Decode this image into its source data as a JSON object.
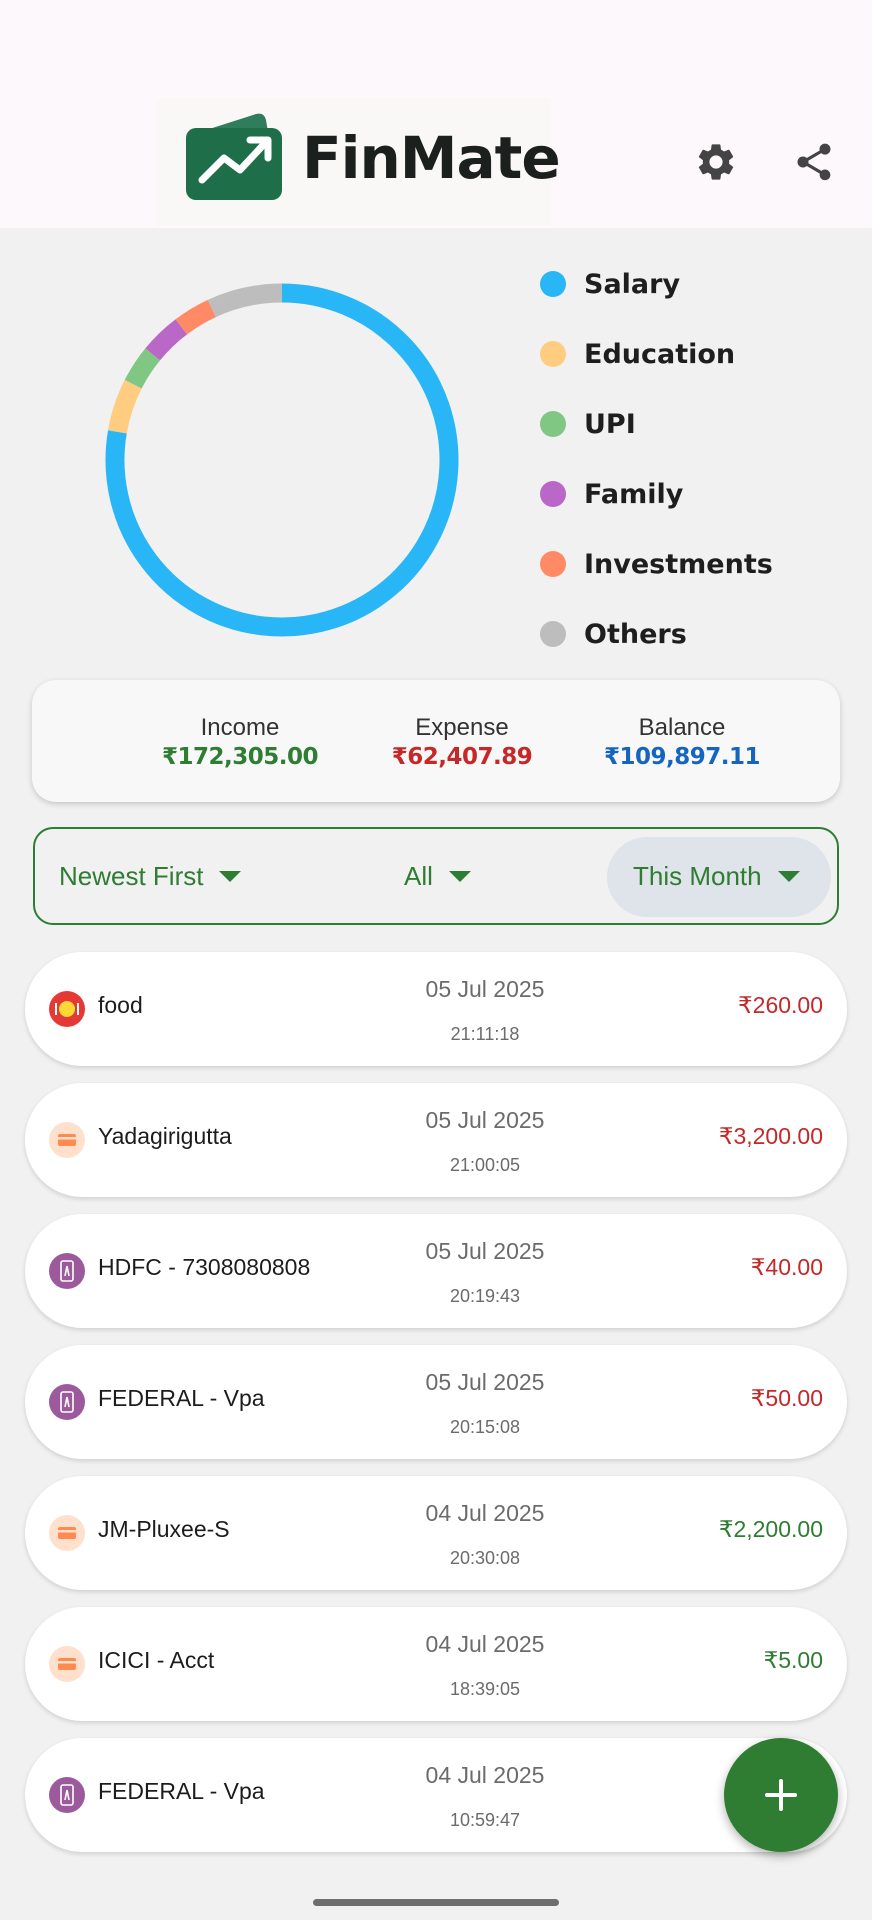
{
  "app": {
    "name": "FinMate"
  },
  "chart_data": {
    "type": "pie",
    "categories": [
      "Salary",
      "Education",
      "UPI",
      "Family",
      "Investments",
      "Others"
    ],
    "values": [
      77.7,
      4.8,
      3.4,
      3.8,
      3.4,
      6.9
    ],
    "colors": [
      "#29b6f6",
      "#ffcc80",
      "#81c784",
      "#ba68c8",
      "#ff8a65",
      "#bdbdbd"
    ],
    "legend_position": "right"
  },
  "legend": [
    {
      "label": "Salary",
      "color": "#29b6f6"
    },
    {
      "label": "Education",
      "color": "#ffcc80"
    },
    {
      "label": "UPI",
      "color": "#81c784"
    },
    {
      "label": "Family",
      "color": "#ba68c8"
    },
    {
      "label": "Investments",
      "color": "#ff8a65"
    },
    {
      "label": "Others",
      "color": "#bdbdbd"
    }
  ],
  "summary": {
    "income_label": "Income",
    "income_value": "₹172,305.00",
    "expense_label": "Expense",
    "expense_value": "₹62,407.89",
    "balance_label": "Balance",
    "balance_value": "₹109,897.11"
  },
  "filters": {
    "sort": "Newest First",
    "type": "All",
    "period": "This Month"
  },
  "transactions": [
    {
      "title": "food",
      "date": "05 Jul 2025",
      "time": "21:11:18",
      "amount": "₹260.00",
      "kind": "expense",
      "icon": "food-icon"
    },
    {
      "title": "Yadagirigutta",
      "date": "05 Jul 2025",
      "time": "21:00:05",
      "amount": "₹3,200.00",
      "kind": "expense",
      "icon": "card-icon"
    },
    {
      "title": "HDFC - 7308080808",
      "date": "05 Jul 2025",
      "time": "20:19:43",
      "amount": "₹40.00",
      "kind": "expense",
      "icon": "upi-phone-icon"
    },
    {
      "title": "FEDERAL - Vpa",
      "date": "05 Jul 2025",
      "time": "20:15:08",
      "amount": "₹50.00",
      "kind": "expense",
      "icon": "upi-phone-icon"
    },
    {
      "title": "JM-Pluxee-S",
      "date": "04 Jul 2025",
      "time": "20:30:08",
      "amount": "₹2,200.00",
      "kind": "income",
      "icon": "card-icon"
    },
    {
      "title": "ICICI - Acct",
      "date": "04 Jul 2025",
      "time": "18:39:05",
      "amount": "₹5.00",
      "kind": "income",
      "icon": "card-icon"
    },
    {
      "title": "FEDERAL - Vpa",
      "date": "04 Jul 2025",
      "time": "10:59:47",
      "amount": "",
      "kind": "expense",
      "icon": "upi-phone-icon"
    }
  ],
  "colors": {
    "primary": "#2e7d32",
    "expense": "#c62828",
    "income": "#2e7d32",
    "balance": "#1565c0"
  }
}
